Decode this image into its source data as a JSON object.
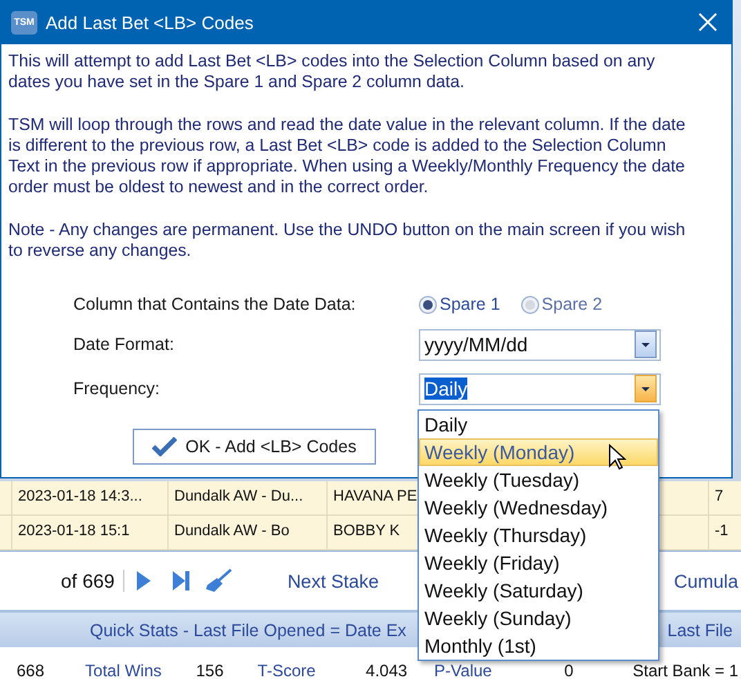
{
  "window": {
    "icon_text": "TSM",
    "title": "Add Last Bet <LB> Codes"
  },
  "paragraphs": [
    "This will attempt to add Last Bet <LB> codes into the Selection Column based on any dates you have set in the Spare 1 and Spare 2 column data.",
    "TSM will loop through the rows and read the date value in the relevant column. If the date is different to the previous row, a Last Bet <LB> code is added to the Selection Column Text in the previous row if appropriate. When using a Weekly/Monthly Frequency the date order must be oldest to newest and in the correct order.",
    "Note - Any changes are permanent. Use the UNDO button on the main screen if you wish to reverse any changes."
  ],
  "date_column": {
    "label": "Column that Contains the Date Data:",
    "options": [
      {
        "label": "Spare 1",
        "selected": true
      },
      {
        "label": "Spare 2",
        "selected": false
      }
    ]
  },
  "date_format": {
    "label": "Date Format:",
    "value": "yyyy/MM/dd"
  },
  "frequency": {
    "label": "Frequency:",
    "value": "Daily",
    "expanded": true,
    "options": [
      {
        "label": "Daily",
        "highlighted": false
      },
      {
        "label": "Weekly (Monday)",
        "highlighted": true
      },
      {
        "label": "Weekly (Tuesday)",
        "highlighted": false
      },
      {
        "label": "Weekly (Wednesday)",
        "highlighted": false
      },
      {
        "label": "Weekly (Thursday)",
        "highlighted": false
      },
      {
        "label": "Weekly (Friday)",
        "highlighted": false
      },
      {
        "label": "Weekly (Saturday)",
        "highlighted": false
      },
      {
        "label": "Weekly (Sunday)",
        "highlighted": false
      },
      {
        "label": "Monthly (1st)",
        "highlighted": false
      }
    ]
  },
  "ok_button": "OK - Add <LB> Codes",
  "background": {
    "table_rows": [
      [
        "2023-01-18 14:3...",
        "Dundalk AW - Du...",
        "HAVANA PE",
        "7"
      ],
      [
        "2023-01-18 15:1",
        "Dundalk AW - Bo",
        "BOBBY K",
        "-1"
      ]
    ],
    "pager": "of 669",
    "next_stake": "Next Stake",
    "cumulative": "Cumula",
    "quick_stats_title": "Quick Stats - Last File Opened = Date Ex",
    "quick_stats_title_2": "Last File",
    "stats": [
      "668",
      "Total Wins",
      "156",
      "T-Score",
      "4.043",
      "P-Value",
      "0"
    ],
    "start_bank": "Start Bank = 1"
  }
}
